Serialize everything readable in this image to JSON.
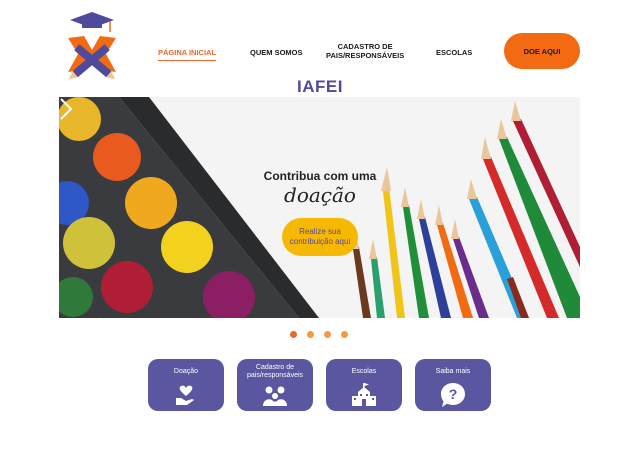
{
  "header": {
    "nav": [
      {
        "label": "PÁGINA INICIAL",
        "active": true
      },
      {
        "label": "QUEM SOMOS",
        "active": false
      },
      {
        "label": "CADASTRO DE\nPAIS/RESPONSÁVEIS",
        "active": false
      },
      {
        "label": "ESCOLAS",
        "active": false
      }
    ],
    "donate_label": "DOE AQUI"
  },
  "site_title": "IAFEI",
  "hero": {
    "line1": "Contribua com uma",
    "line2": "doação",
    "button_label": "Realize sua contribuição aqui"
  },
  "slider": {
    "dot_count": 4
  },
  "cards": [
    {
      "label": "Doação",
      "icon": "heart-hand-icon"
    },
    {
      "label": "Cadastro de pais/responsáveis",
      "icon": "family-icon"
    },
    {
      "label": "Escolas",
      "icon": "school-icon"
    },
    {
      "label": "Saiba mais",
      "icon": "question-icon"
    }
  ],
  "colors": {
    "brand_purple": "#5a569f",
    "accent_orange": "#f26b12",
    "button_yellow": "#f6b800"
  }
}
